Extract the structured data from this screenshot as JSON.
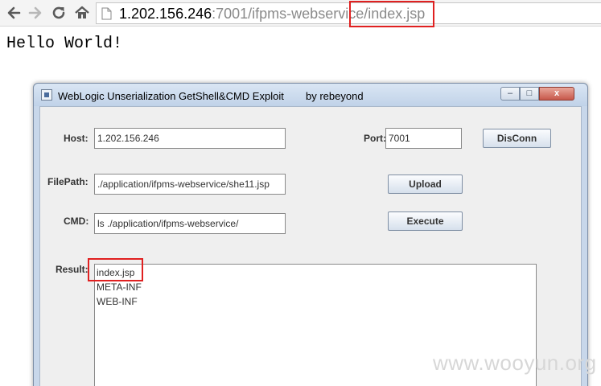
{
  "browser": {
    "url_host": "1.202.156.246",
    "url_rest": ":7001/ifpms-webservice/index.jsp",
    "icons": [
      "back-icon",
      "forward-icon",
      "reload-icon",
      "home-icon",
      "page-icon"
    ]
  },
  "page": {
    "body_text": "Hello World!"
  },
  "window": {
    "title": "WebLogic Unserialization GetShell&CMD Exploit",
    "author": "by rebeyond",
    "controls": {
      "minimize": "–",
      "maximize": "□",
      "close": "x"
    }
  },
  "form": {
    "host_label": "Host:",
    "host_value": "1.202.156.246",
    "port_label": "Port:",
    "port_value": "7001",
    "disconnect_label": "DisConn",
    "filepath_label": "FilePath:",
    "filepath_value": "./application/ifpms-webservice/she11.jsp",
    "upload_label": "Upload",
    "cmd_label": "CMD:",
    "cmd_value": "ls ./application/ifpms-webservice/",
    "execute_label": "Execute",
    "result_label": "Result:",
    "result_lines": [
      "index.jsp",
      "META-INF",
      "WEB-INF"
    ]
  },
  "watermark": "www.wooyun.org",
  "colors": {
    "highlight": "#e02020",
    "window_frame": "#c8d7ea"
  }
}
